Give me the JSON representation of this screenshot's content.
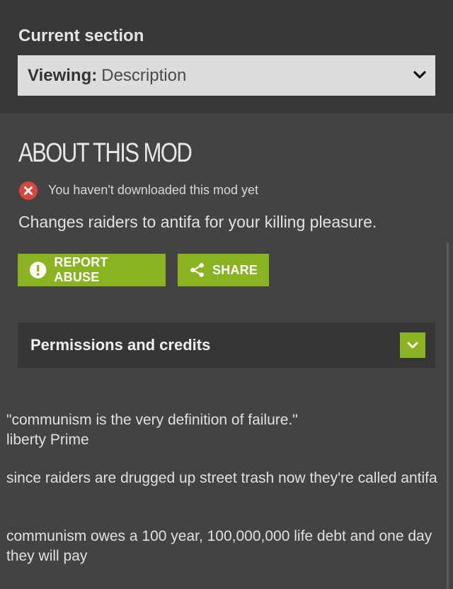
{
  "section": {
    "label": "Current section",
    "select_prefix": "Viewing:",
    "select_value": "Description"
  },
  "about": {
    "heading": "ABOUT THIS MOD",
    "status_text": "You haven't downloaded this mod yet",
    "summary": "Changes raiders to antifa for your killing pleasure."
  },
  "actions": {
    "report_label": "REPORT ABUSE",
    "share_label": "SHARE"
  },
  "permissions": {
    "title": "Permissions and credits"
  },
  "description": {
    "paragraph_1_line_1": "\"communism is the very definition of failure.\"",
    "paragraph_1_line_2": "liberty Prime",
    "paragraph_2": "since raiders are drugged up street trash now they're called antifa",
    "paragraph_3": "communism owes a 100 year, 100,000,000 life debt and one day they will pay"
  },
  "colors": {
    "accent_green": "#8ab322",
    "error_red": "#d9453b",
    "page_bg": "#434343",
    "panel_bg": "#383838"
  },
  "icons": {
    "select_chevron": "chevron-down-icon",
    "status": "error-x-icon",
    "report": "exclamation-icon",
    "share": "share-icon",
    "accordion_toggle": "chevron-down-icon"
  }
}
